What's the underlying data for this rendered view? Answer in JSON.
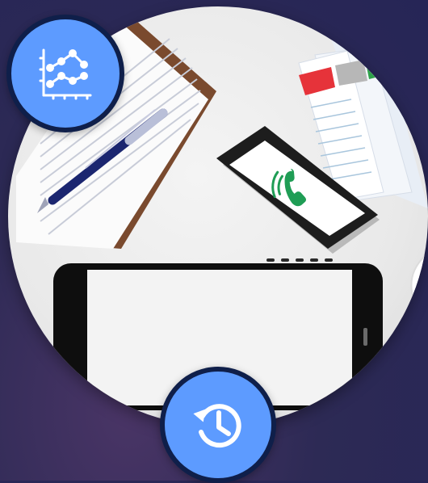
{
  "screen": {
    "hero_image": "desk-with-devices-illustration"
  },
  "buttons": {
    "chart": {
      "icon": "line-chart-icon"
    },
    "history": {
      "icon": "history-icon"
    }
  },
  "colors": {
    "background": "#2d2a55",
    "button_fill": "#5d9bff",
    "button_border": "#0f1f4a",
    "call_green": "#1f9d55"
  }
}
